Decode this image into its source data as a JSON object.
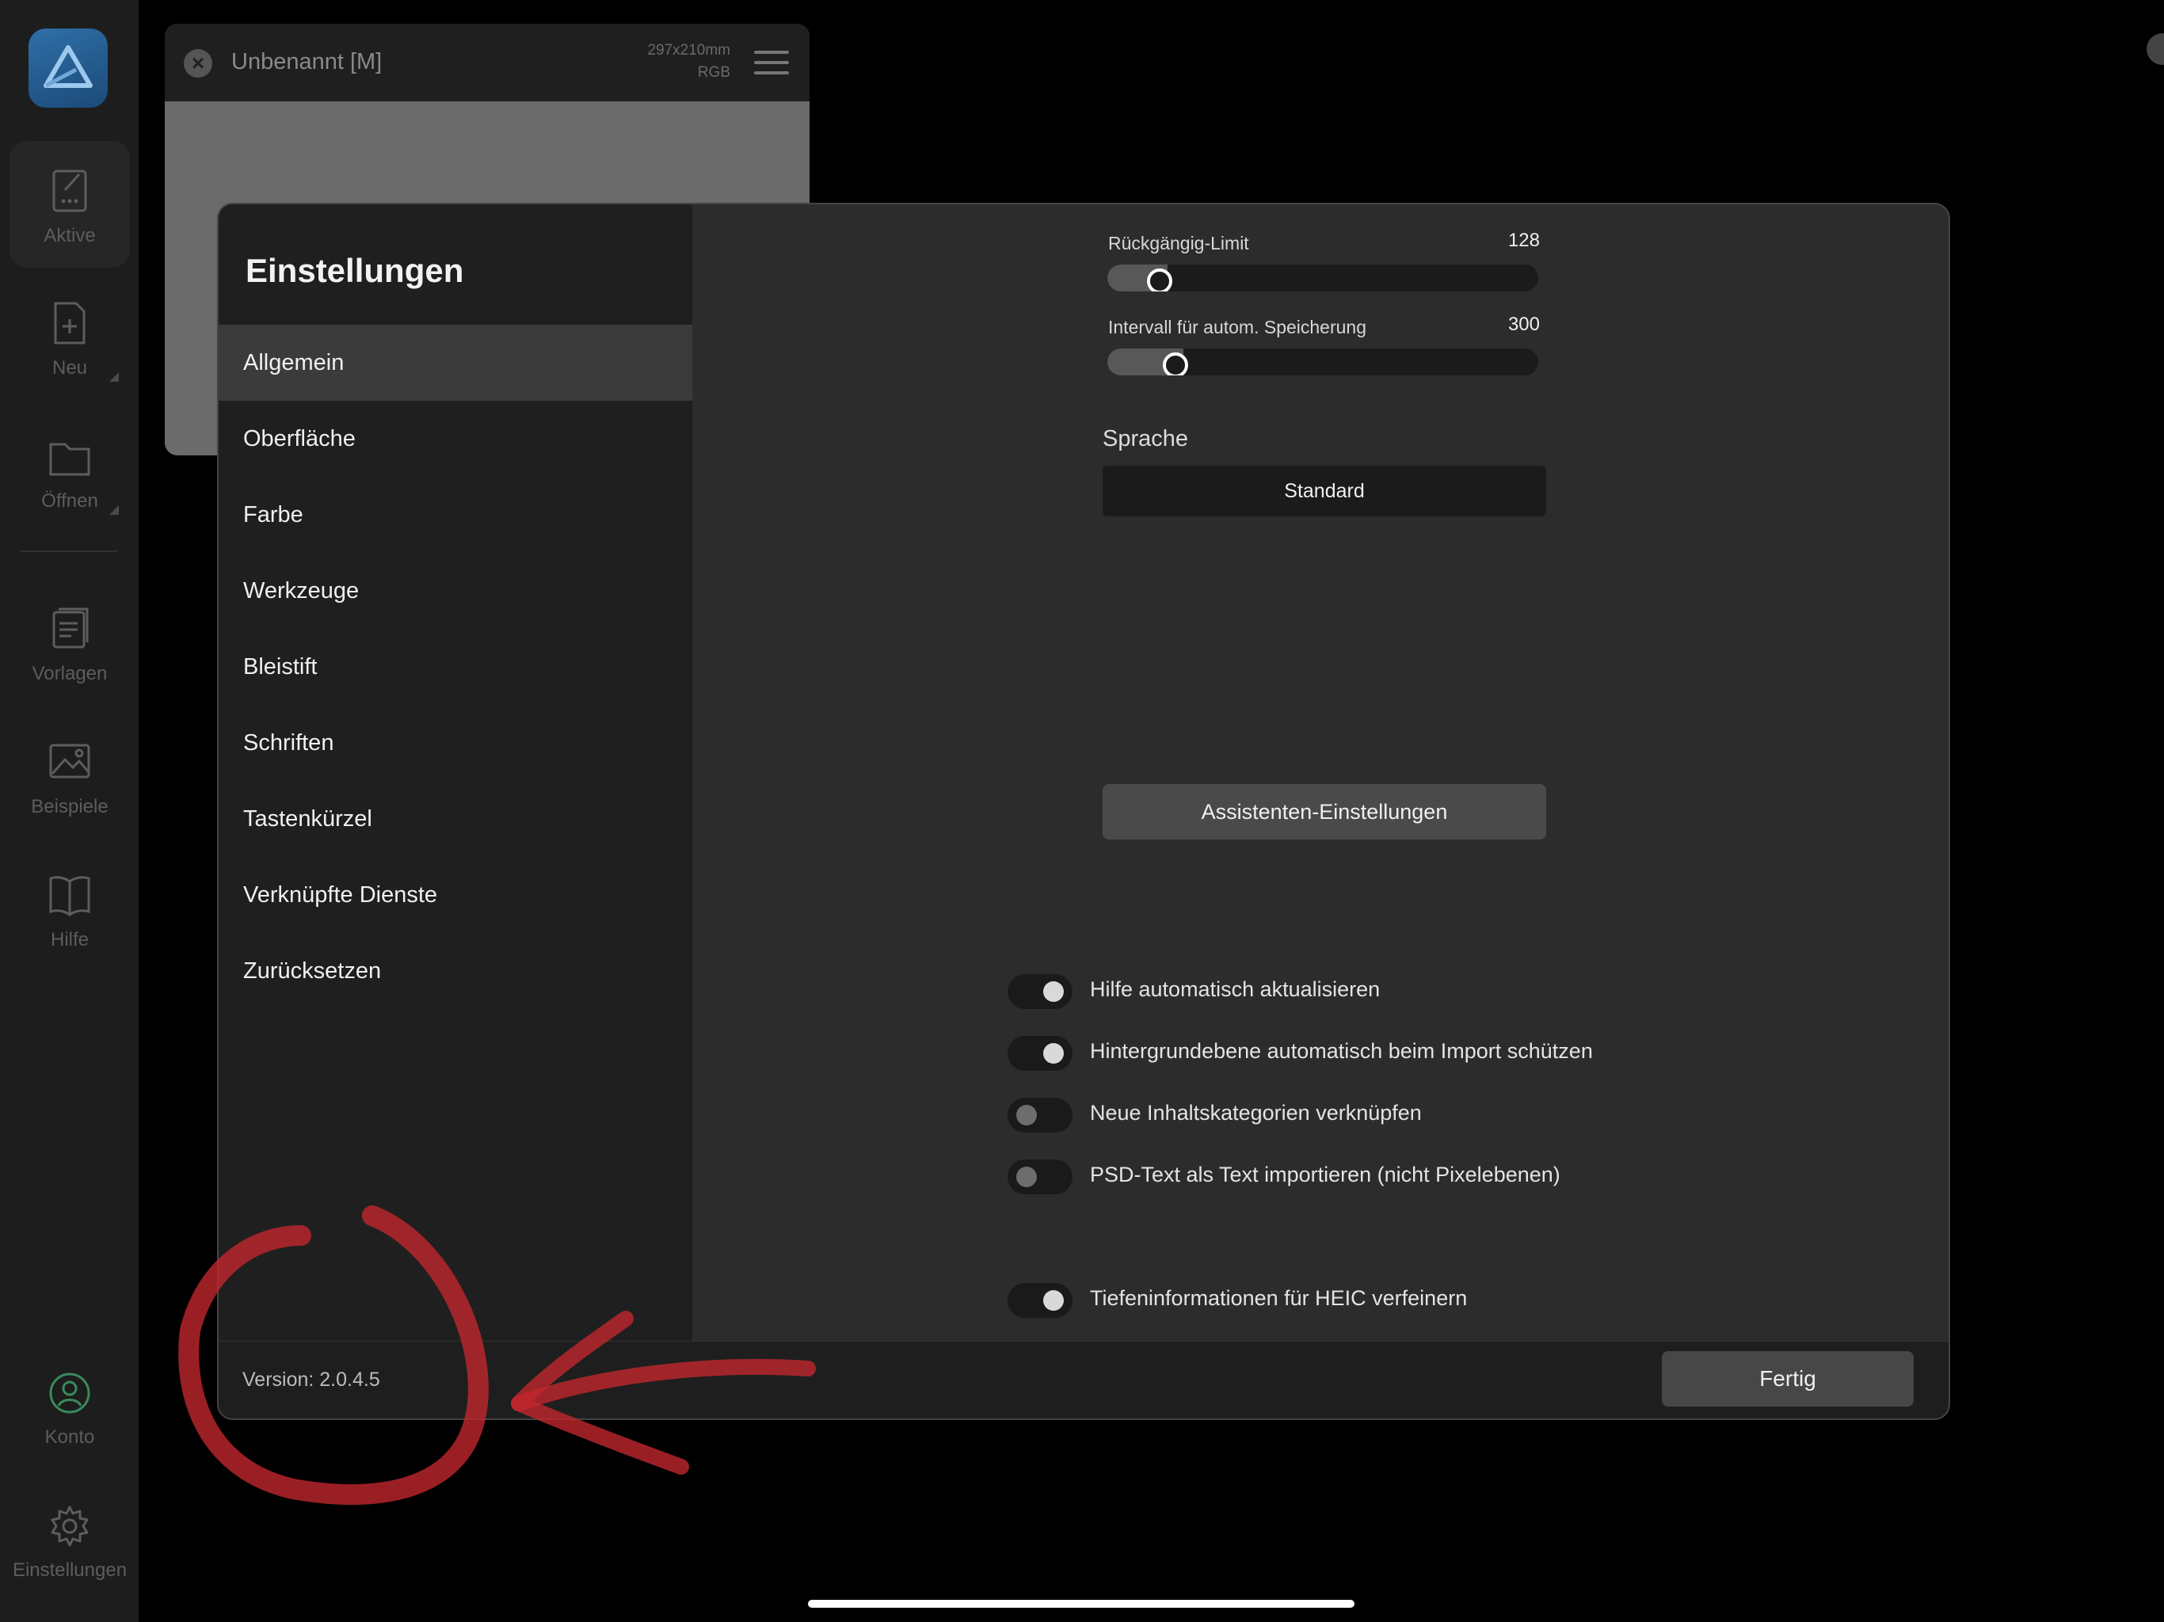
{
  "rail": {
    "items": [
      {
        "label": "Aktive",
        "icon": "edit-document-icon"
      },
      {
        "label": "Neu",
        "icon": "new-document-icon"
      },
      {
        "label": "Öffnen",
        "icon": "folder-icon"
      },
      {
        "label": "Vorlagen",
        "icon": "templates-icon"
      },
      {
        "label": "Beispiele",
        "icon": "image-icon"
      },
      {
        "label": "Hilfe",
        "icon": "book-icon"
      },
      {
        "label": "Konto",
        "icon": "account-icon"
      },
      {
        "label": "Einstellungen",
        "icon": "gear-icon"
      }
    ],
    "accent": "#3a8a5c"
  },
  "document": {
    "title": "Unbenannt [M]",
    "size": "297x210mm",
    "color_mode": "RGB"
  },
  "dialog": {
    "title": "Einstellungen",
    "nav": [
      "Allgemein",
      "Oberfläche",
      "Farbe",
      "Werkzeuge",
      "Bleistift",
      "Schriften",
      "Tastenkürzel",
      "Verknüpfte Dienste",
      "Zurücksetzen"
    ],
    "selected_nav": "Allgemein",
    "version": "Version: 2.0.4.5",
    "done_label": "Fertig"
  },
  "general": {
    "undo_limit": {
      "label": "Rückgängig-Limit",
      "value": "128",
      "fraction": 0.08
    },
    "autosave": {
      "label": "Intervall für autom. Speicherung",
      "value": "300",
      "fraction": 0.12
    },
    "language_label": "Sprache",
    "language_value": "Standard",
    "assistant_button": "Assistenten-Einstellungen",
    "toggles": [
      {
        "label": "Hilfe automatisch aktualisieren",
        "on": true
      },
      {
        "label": "Hintergrundebene automatisch beim Import schützen",
        "on": true
      },
      {
        "label": "Neue Inhaltskategorien verknüpfen",
        "on": false
      },
      {
        "label": "PSD-Text als Text importieren (nicht Pixelebenen)",
        "on": false
      },
      {
        "label": "Tiefeninformationen für HEIC verfeinern",
        "on": true
      }
    ]
  },
  "annotation_color": "#c0272d"
}
